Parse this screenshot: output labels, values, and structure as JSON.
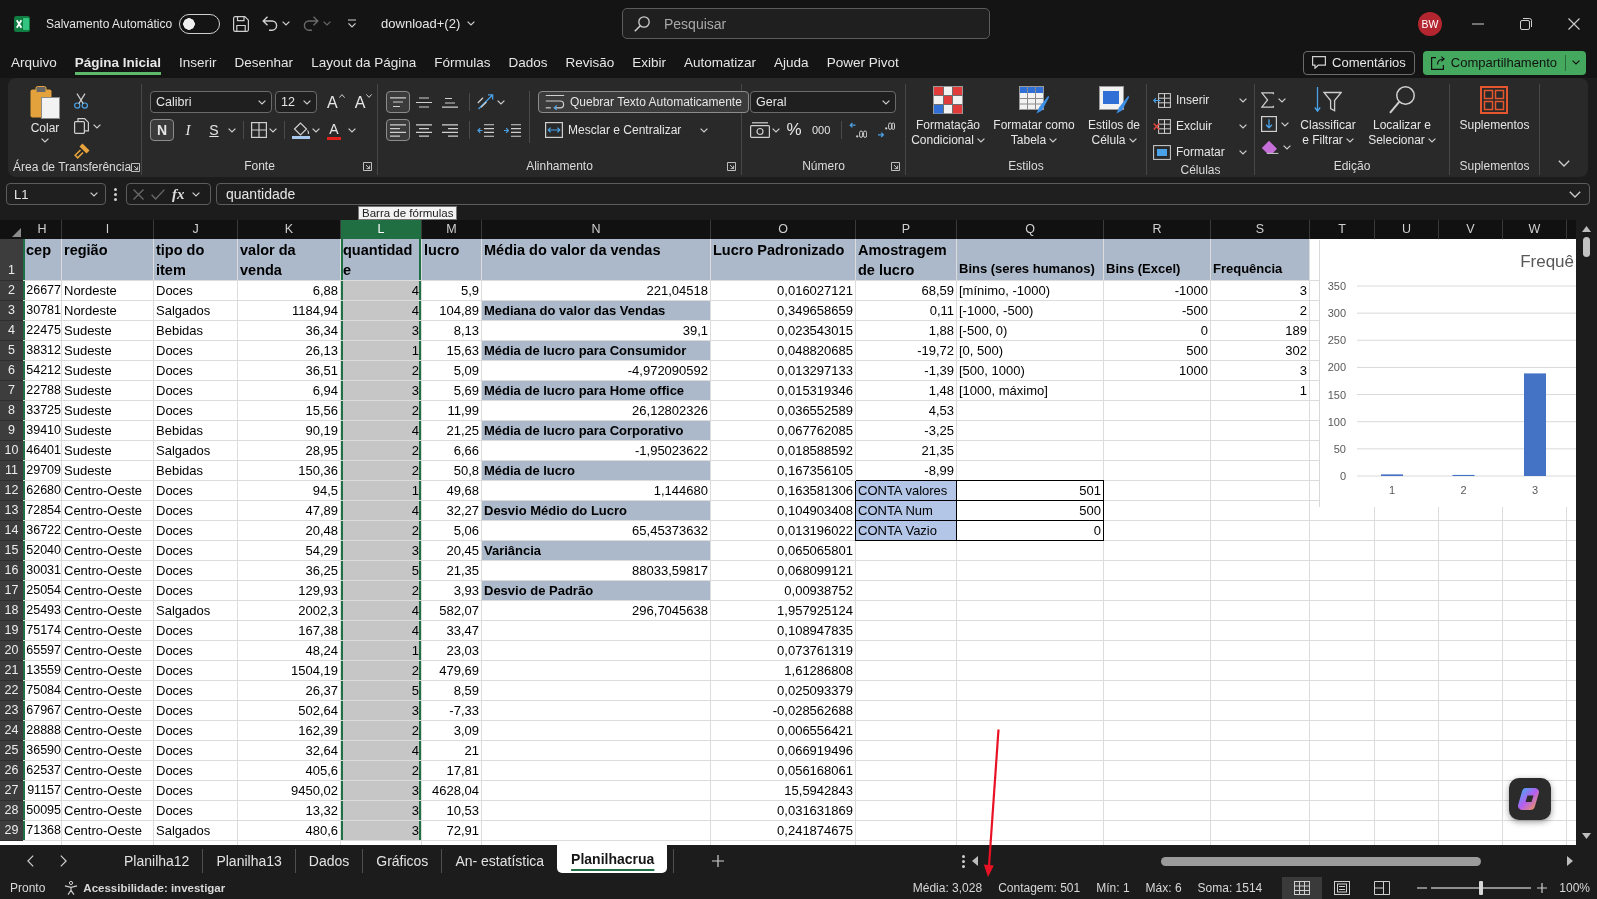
{
  "titlebar": {
    "autosave": {
      "label": "Salvamento Automático",
      "on": false
    },
    "quick_access": [
      {
        "kind": "save",
        "disabled": false
      },
      {
        "kind": "undo",
        "disabled": false
      },
      {
        "kind": "redo",
        "disabled": true
      }
    ],
    "file_name": "download+(2)",
    "search": {
      "placeholder": "Pesquisar"
    },
    "avatar": "BW"
  },
  "menu": {
    "tabs": [
      {
        "label": "Arquivo",
        "selected": false
      },
      {
        "label": "Página Inicial",
        "selected": true
      },
      {
        "label": "Inserir",
        "selected": false
      },
      {
        "label": "Desenhar",
        "selected": false
      },
      {
        "label": "Layout da Página",
        "selected": false
      },
      {
        "label": "Fórmulas",
        "selected": false
      },
      {
        "label": "Dados",
        "selected": false
      },
      {
        "label": "Revisão",
        "selected": false
      },
      {
        "label": "Exibir",
        "selected": false
      },
      {
        "label": "Automatizar",
        "selected": false
      },
      {
        "label": "Ajuda",
        "selected": false
      },
      {
        "label": "Power Pivot",
        "selected": false
      }
    ],
    "comments": "Comentários",
    "share": "Compartilhamento"
  },
  "ribbon": {
    "clipboard": {
      "label": "Área de Transferência",
      "paste": "Colar"
    },
    "font": {
      "label": "Fonte",
      "family": "Calibri",
      "size": "12",
      "grow": "A",
      "shrink": "A",
      "styles": [
        {
          "kind": "bold",
          "label": "N",
          "on": true
        },
        {
          "kind": "italic",
          "label": "I",
          "on": false
        },
        {
          "kind": "underline",
          "label": "S",
          "on": false
        }
      ],
      "paint_letter": "A"
    },
    "alignment": {
      "label": "Alinhamento",
      "vertical": [
        {
          "kind": "top",
          "on": true
        },
        {
          "kind": "middle",
          "on": false
        },
        {
          "kind": "bottom",
          "on": false
        }
      ],
      "horizontal": [
        {
          "kind": "left",
          "on": true
        },
        {
          "kind": "center",
          "on": false
        },
        {
          "kind": "right",
          "on": false
        }
      ],
      "wrap": {
        "label": "Quebrar Texto Automaticamente",
        "on": true
      },
      "merge": "Mesclar e Centralizar"
    },
    "number": {
      "label": "Número",
      "format": "Geral",
      "percent": "%",
      "thousands": "000"
    },
    "styles": {
      "label": "Estilos",
      "buttons": [
        "Formatação Condicional",
        "Formatar como Tabela",
        "Estilos de Célula"
      ]
    },
    "cells": {
      "label": "Células",
      "buttons": [
        "Inserir",
        "Excluir",
        "Formatar"
      ]
    },
    "editing": {
      "label": "Edição",
      "buttons": [
        "Classificar e Filtrar",
        "Localizar e Selecionar"
      ]
    },
    "addins": {
      "label": "Suplementos",
      "button": "Suplementos"
    }
  },
  "formula_bar": {
    "name_box": "L1",
    "function_label": "fx",
    "value": "quantidade",
    "tooltip": "Barra de fórmulas"
  },
  "sheet": {
    "columns": [
      {
        "label": "H",
        "selected": false
      },
      {
        "label": "I",
        "selected": false
      },
      {
        "label": "J",
        "selected": false
      },
      {
        "label": "K",
        "selected": false
      },
      {
        "label": "L",
        "selected": true
      },
      {
        "label": "M",
        "selected": false
      },
      {
        "label": "N",
        "selected": false
      },
      {
        "label": "O",
        "selected": false
      },
      {
        "label": "P",
        "selected": false
      },
      {
        "label": "Q",
        "selected": false
      },
      {
        "label": "R",
        "selected": false
      },
      {
        "label": "S",
        "selected": false
      },
      {
        "label": "T",
        "selected": false
      },
      {
        "label": "U",
        "selected": false
      },
      {
        "label": "V",
        "selected": false
      },
      {
        "label": "W",
        "selected": false
      }
    ],
    "rows": [
      {
        "number": "1",
        "cells": {
          "H": {
            "text": "cep",
            "kind": "head"
          },
          "I": {
            "text": "região",
            "kind": "head"
          },
          "J": {
            "text": "tipo do item",
            "kind": "head"
          },
          "K": {
            "text": "valor da venda",
            "kind": "head"
          },
          "L": {
            "text": "quantidade",
            "kind": "head"
          },
          "M": {
            "text": "lucro",
            "kind": "head"
          },
          "N": {
            "text": "Média do valor da vendas",
            "kind": "head"
          },
          "O": {
            "text": "Lucro Padronizado",
            "kind": "head"
          },
          "P": {
            "text": "Amostragem de lucro",
            "kind": "head"
          },
          "Q": {
            "text": "Bins (seres humanos)",
            "kind": "head_low"
          },
          "R": {
            "text": "Bins (Excel)",
            "kind": "head_low"
          },
          "S": {
            "text": "Frequência",
            "kind": "head_low"
          }
        }
      },
      {
        "number": "2",
        "cells": {
          "H": {
            "text": "26677",
            "kind": "number"
          },
          "I": {
            "text": "Nordeste",
            "kind": "text"
          },
          "J": {
            "text": "Doces",
            "kind": "text"
          },
          "K": {
            "text": "6,88",
            "kind": "number"
          },
          "L": {
            "text": "4",
            "kind": "number"
          },
          "M": {
            "text": "5,9",
            "kind": "number"
          },
          "N": {
            "text": "221,04518",
            "kind": "number"
          },
          "O": {
            "text": "0,016027121",
            "kind": "number"
          },
          "P": {
            "text": "68,59",
            "kind": "number"
          },
          "Q": {
            "text": "[mínimo, -1000)",
            "kind": "text"
          },
          "R": {
            "text": "-1000",
            "kind": "number"
          },
          "S": {
            "text": "3",
            "kind": "number"
          }
        }
      },
      {
        "number": "3",
        "cells": {
          "H": {
            "text": "30781",
            "kind": "number"
          },
          "I": {
            "text": "Nordeste",
            "kind": "text"
          },
          "J": {
            "text": "Salgados",
            "kind": "text"
          },
          "K": {
            "text": "1184,94",
            "kind": "number"
          },
          "L": {
            "text": "4",
            "kind": "number"
          },
          "M": {
            "text": "104,89",
            "kind": "number"
          },
          "N": {
            "text": "Mediana do valor das Vendas",
            "kind": "label"
          },
          "O": {
            "text": "0,349658659",
            "kind": "number"
          },
          "P": {
            "text": "0,11",
            "kind": "number"
          },
          "Q": {
            "text": "[-1000, -500)",
            "kind": "text"
          },
          "R": {
            "text": "-500",
            "kind": "number"
          },
          "S": {
            "text": "2",
            "kind": "number"
          }
        }
      },
      {
        "number": "4",
        "cells": {
          "H": {
            "text": "22475",
            "kind": "number"
          },
          "I": {
            "text": "Sudeste",
            "kind": "text"
          },
          "J": {
            "text": "Bebidas",
            "kind": "text"
          },
          "K": {
            "text": "36,34",
            "kind": "number"
          },
          "L": {
            "text": "3",
            "kind": "number"
          },
          "M": {
            "text": "8,13",
            "kind": "number"
          },
          "N": {
            "text": "39,1",
            "kind": "number"
          },
          "O": {
            "text": "0,023543015",
            "kind": "number"
          },
          "P": {
            "text": "1,88",
            "kind": "number"
          },
          "Q": {
            "text": "[-500, 0)",
            "kind": "text"
          },
          "R": {
            "text": "0",
            "kind": "number"
          },
          "S": {
            "text": "189",
            "kind": "number"
          }
        }
      },
      {
        "number": "5",
        "cells": {
          "H": {
            "text": "38312",
            "kind": "number"
          },
          "I": {
            "text": "Sudeste",
            "kind": "text"
          },
          "J": {
            "text": "Doces",
            "kind": "text"
          },
          "K": {
            "text": "26,13",
            "kind": "number"
          },
          "L": {
            "text": "1",
            "kind": "number"
          },
          "M": {
            "text": "15,63",
            "kind": "number"
          },
          "N": {
            "text": "Média de lucro para Consumidor",
            "kind": "label"
          },
          "O": {
            "text": "0,048820685",
            "kind": "number"
          },
          "P": {
            "text": "-19,72",
            "kind": "number"
          },
          "Q": {
            "text": "[0, 500)",
            "kind": "text"
          },
          "R": {
            "text": "500",
            "kind": "number"
          },
          "S": {
            "text": "302",
            "kind": "number"
          }
        }
      },
      {
        "number": "6",
        "cells": {
          "H": {
            "text": "54212",
            "kind": "number"
          },
          "I": {
            "text": "Sudeste",
            "kind": "text"
          },
          "J": {
            "text": "Doces",
            "kind": "text"
          },
          "K": {
            "text": "36,51",
            "kind": "number"
          },
          "L": {
            "text": "2",
            "kind": "number"
          },
          "M": {
            "text": "5,09",
            "kind": "number"
          },
          "N": {
            "text": "-4,972090592",
            "kind": "number"
          },
          "O": {
            "text": "0,013297133",
            "kind": "number"
          },
          "P": {
            "text": "-1,39",
            "kind": "number"
          },
          "Q": {
            "text": "[500, 1000)",
            "kind": "text"
          },
          "R": {
            "text": "1000",
            "kind": "number"
          },
          "S": {
            "text": "3",
            "kind": "number"
          }
        }
      },
      {
        "number": "7",
        "cells": {
          "H": {
            "text": "22788",
            "kind": "number"
          },
          "I": {
            "text": "Sudeste",
            "kind": "text"
          },
          "J": {
            "text": "Doces",
            "kind": "text"
          },
          "K": {
            "text": "6,94",
            "kind": "number"
          },
          "L": {
            "text": "3",
            "kind": "number"
          },
          "M": {
            "text": "5,69",
            "kind": "number"
          },
          "N": {
            "text": "Média de lucro para Home office",
            "kind": "label"
          },
          "O": {
            "text": "0,015319346",
            "kind": "number"
          },
          "P": {
            "text": "1,48",
            "kind": "number"
          },
          "Q": {
            "text": "[1000, máximo]",
            "kind": "text"
          },
          "S": {
            "text": "1",
            "kind": "number"
          }
        }
      },
      {
        "number": "8",
        "cells": {
          "H": {
            "text": "33725",
            "kind": "number"
          },
          "I": {
            "text": "Sudeste",
            "kind": "text"
          },
          "J": {
            "text": "Doces",
            "kind": "text"
          },
          "K": {
            "text": "15,56",
            "kind": "number"
          },
          "L": {
            "text": "2",
            "kind": "number"
          },
          "M": {
            "text": "11,99",
            "kind": "number"
          },
          "N": {
            "text": "26,12802326",
            "kind": "number"
          },
          "O": {
            "text": "0,036552589",
            "kind": "number"
          },
          "P": {
            "text": "4,53",
            "kind": "number"
          }
        }
      },
      {
        "number": "9",
        "cells": {
          "H": {
            "text": "39410",
            "kind": "number"
          },
          "I": {
            "text": "Sudeste",
            "kind": "text"
          },
          "J": {
            "text": "Bebidas",
            "kind": "text"
          },
          "K": {
            "text": "90,19",
            "kind": "number"
          },
          "L": {
            "text": "4",
            "kind": "number"
          },
          "M": {
            "text": "21,25",
            "kind": "number"
          },
          "N": {
            "text": "Média de lucro para Corporativo",
            "kind": "label"
          },
          "O": {
            "text": "0,067762085",
            "kind": "number"
          },
          "P": {
            "text": "-3,25",
            "kind": "number"
          }
        }
      },
      {
        "number": "10",
        "cells": {
          "H": {
            "text": "46401",
            "kind": "number"
          },
          "I": {
            "text": "Sudeste",
            "kind": "text"
          },
          "J": {
            "text": "Salgados",
            "kind": "text"
          },
          "K": {
            "text": "28,95",
            "kind": "number"
          },
          "L": {
            "text": "2",
            "kind": "number"
          },
          "M": {
            "text": "6,66",
            "kind": "number"
          },
          "N": {
            "text": "-1,95023622",
            "kind": "number"
          },
          "O": {
            "text": "0,018588592",
            "kind": "number"
          },
          "P": {
            "text": "21,35",
            "kind": "number"
          }
        }
      },
      {
        "number": "11",
        "cells": {
          "H": {
            "text": "29709",
            "kind": "number"
          },
          "I": {
            "text": "Sudeste",
            "kind": "text"
          },
          "J": {
            "text": "Bebidas",
            "kind": "text"
          },
          "K": {
            "text": "150,36",
            "kind": "number"
          },
          "L": {
            "text": "2",
            "kind": "number"
          },
          "M": {
            "text": "50,8",
            "kind": "number"
          },
          "N": {
            "text": "Média de lucro",
            "kind": "label"
          },
          "O": {
            "text": "0,167356105",
            "kind": "number"
          },
          "P": {
            "text": "-8,99",
            "kind": "number"
          }
        }
      },
      {
        "number": "12",
        "cells": {
          "H": {
            "text": "62680",
            "kind": "number"
          },
          "I": {
            "text": "Centro-Oeste",
            "kind": "text"
          },
          "J": {
            "text": "Doces",
            "kind": "text"
          },
          "K": {
            "text": "94,5",
            "kind": "number"
          },
          "L": {
            "text": "1",
            "kind": "number"
          },
          "M": {
            "text": "49,68",
            "kind": "number"
          },
          "N": {
            "text": "1,144680",
            "kind": "number"
          },
          "O": {
            "text": "0,163581306",
            "kind": "number"
          },
          "P": {
            "text": "CONTA valores",
            "kind": "box_label"
          },
          "Q": {
            "text": "501",
            "kind": "box_value"
          }
        }
      },
      {
        "number": "13",
        "cells": {
          "H": {
            "text": "72854",
            "kind": "number"
          },
          "I": {
            "text": "Centro-Oeste",
            "kind": "text"
          },
          "J": {
            "text": "Doces",
            "kind": "text"
          },
          "K": {
            "text": "47,89",
            "kind": "number"
          },
          "L": {
            "text": "4",
            "kind": "number"
          },
          "M": {
            "text": "32,27",
            "kind": "number"
          },
          "N": {
            "text": "Desvio Médio do Lucro",
            "kind": "label"
          },
          "O": {
            "text": "0,104903408",
            "kind": "number"
          },
          "P": {
            "text": "CONTA Num",
            "kind": "box_label"
          },
          "Q": {
            "text": "500",
            "kind": "box_value"
          }
        }
      },
      {
        "number": "14",
        "cells": {
          "H": {
            "text": "36722",
            "kind": "number"
          },
          "I": {
            "text": "Centro-Oeste",
            "kind": "text"
          },
          "J": {
            "text": "Doces",
            "kind": "text"
          },
          "K": {
            "text": "20,48",
            "kind": "number"
          },
          "L": {
            "text": "2",
            "kind": "number"
          },
          "M": {
            "text": "5,06",
            "kind": "number"
          },
          "N": {
            "text": "65,45373632",
            "kind": "number"
          },
          "O": {
            "text": "0,013196022",
            "kind": "number"
          },
          "P": {
            "text": "CONTA Vazio",
            "kind": "box_label"
          },
          "Q": {
            "text": "0",
            "kind": "box_value"
          }
        }
      },
      {
        "number": "15",
        "cells": {
          "H": {
            "text": "52040",
            "kind": "number"
          },
          "I": {
            "text": "Centro-Oeste",
            "kind": "text"
          },
          "J": {
            "text": "Doces",
            "kind": "text"
          },
          "K": {
            "text": "54,29",
            "kind": "number"
          },
          "L": {
            "text": "3",
            "kind": "number"
          },
          "M": {
            "text": "20,45",
            "kind": "number"
          },
          "N": {
            "text": "Variância",
            "kind": "label"
          },
          "O": {
            "text": "0,065065801",
            "kind": "number"
          }
        }
      },
      {
        "number": "16",
        "cells": {
          "H": {
            "text": "30031",
            "kind": "number"
          },
          "I": {
            "text": "Centro-Oeste",
            "kind": "text"
          },
          "J": {
            "text": "Doces",
            "kind": "text"
          },
          "K": {
            "text": "36,25",
            "kind": "number"
          },
          "L": {
            "text": "5",
            "kind": "number"
          },
          "M": {
            "text": "21,35",
            "kind": "number"
          },
          "N": {
            "text": "88033,59817",
            "kind": "number"
          },
          "O": {
            "text": "0,068099121",
            "kind": "number"
          }
        }
      },
      {
        "number": "17",
        "cells": {
          "H": {
            "text": "25054",
            "kind": "number"
          },
          "I": {
            "text": "Centro-Oeste",
            "kind": "text"
          },
          "J": {
            "text": "Doces",
            "kind": "text"
          },
          "K": {
            "text": "129,93",
            "kind": "number"
          },
          "L": {
            "text": "2",
            "kind": "number"
          },
          "M": {
            "text": "3,93",
            "kind": "number"
          },
          "N": {
            "text": "Desvio de Padrão",
            "kind": "label"
          },
          "O": {
            "text": "0,00938752",
            "kind": "number"
          }
        }
      },
      {
        "number": "18",
        "cells": {
          "H": {
            "text": "25493",
            "kind": "number"
          },
          "I": {
            "text": "Centro-Oeste",
            "kind": "text"
          },
          "J": {
            "text": "Salgados",
            "kind": "text"
          },
          "K": {
            "text": "2002,3",
            "kind": "number"
          },
          "L": {
            "text": "4",
            "kind": "number"
          },
          "M": {
            "text": "582,07",
            "kind": "number"
          },
          "N": {
            "text": "296,7045638",
            "kind": "number"
          },
          "O": {
            "text": "1,957925124",
            "kind": "number"
          }
        }
      },
      {
        "number": "19",
        "cells": {
          "H": {
            "text": "75174",
            "kind": "number"
          },
          "I": {
            "text": "Centro-Oeste",
            "kind": "text"
          },
          "J": {
            "text": "Doces",
            "kind": "text"
          },
          "K": {
            "text": "167,38",
            "kind": "number"
          },
          "L": {
            "text": "4",
            "kind": "number"
          },
          "M": {
            "text": "33,47",
            "kind": "number"
          },
          "O": {
            "text": "0,108947835",
            "kind": "number"
          }
        }
      },
      {
        "number": "20",
        "cells": {
          "H": {
            "text": "65597",
            "kind": "number"
          },
          "I": {
            "text": "Centro-Oeste",
            "kind": "text"
          },
          "J": {
            "text": "Doces",
            "kind": "text"
          },
          "K": {
            "text": "48,24",
            "kind": "number"
          },
          "L": {
            "text": "1",
            "kind": "number"
          },
          "M": {
            "text": "23,03",
            "kind": "number"
          },
          "O": {
            "text": "0,073761319",
            "kind": "number"
          }
        }
      },
      {
        "number": "21",
        "cells": {
          "H": {
            "text": "13559",
            "kind": "number"
          },
          "I": {
            "text": "Centro-Oeste",
            "kind": "text"
          },
          "J": {
            "text": "Doces",
            "kind": "text"
          },
          "K": {
            "text": "1504,19",
            "kind": "number"
          },
          "L": {
            "text": "2",
            "kind": "number"
          },
          "M": {
            "text": "479,69",
            "kind": "number"
          },
          "O": {
            "text": "1,61286808",
            "kind": "number"
          }
        }
      },
      {
        "number": "22",
        "cells": {
          "H": {
            "text": "75084",
            "kind": "number"
          },
          "I": {
            "text": "Centro-Oeste",
            "kind": "text"
          },
          "J": {
            "text": "Doces",
            "kind": "text"
          },
          "K": {
            "text": "26,37",
            "kind": "number"
          },
          "L": {
            "text": "5",
            "kind": "number"
          },
          "M": {
            "text": "8,59",
            "kind": "number"
          },
          "O": {
            "text": "0,025093379",
            "kind": "number"
          }
        }
      },
      {
        "number": "23",
        "cells": {
          "H": {
            "text": "67967",
            "kind": "number"
          },
          "I": {
            "text": "Centro-Oeste",
            "kind": "text"
          },
          "J": {
            "text": "Doces",
            "kind": "text"
          },
          "K": {
            "text": "502,64",
            "kind": "number"
          },
          "L": {
            "text": "3",
            "kind": "number"
          },
          "M": {
            "text": "-7,33",
            "kind": "number"
          },
          "O": {
            "text": "-0,028562688",
            "kind": "number"
          }
        }
      },
      {
        "number": "24",
        "cells": {
          "H": {
            "text": "28888",
            "kind": "number"
          },
          "I": {
            "text": "Centro-Oeste",
            "kind": "text"
          },
          "J": {
            "text": "Doces",
            "kind": "text"
          },
          "K": {
            "text": "162,39",
            "kind": "number"
          },
          "L": {
            "text": "2",
            "kind": "number"
          },
          "M": {
            "text": "3,09",
            "kind": "number"
          },
          "O": {
            "text": "0,006556421",
            "kind": "number"
          }
        }
      },
      {
        "number": "25",
        "cells": {
          "H": {
            "text": "36590",
            "kind": "number"
          },
          "I": {
            "text": "Centro-Oeste",
            "kind": "text"
          },
          "J": {
            "text": "Doces",
            "kind": "text"
          },
          "K": {
            "text": "32,64",
            "kind": "number"
          },
          "L": {
            "text": "4",
            "kind": "number"
          },
          "M": {
            "text": "21",
            "kind": "number"
          },
          "O": {
            "text": "0,066919496",
            "kind": "number"
          }
        }
      },
      {
        "number": "26",
        "cells": {
          "H": {
            "text": "62537",
            "kind": "number"
          },
          "I": {
            "text": "Centro-Oeste",
            "kind": "text"
          },
          "J": {
            "text": "Doces",
            "kind": "text"
          },
          "K": {
            "text": "405,6",
            "kind": "number"
          },
          "L": {
            "text": "2",
            "kind": "number"
          },
          "M": {
            "text": "17,81",
            "kind": "number"
          },
          "O": {
            "text": "0,056168061",
            "kind": "number"
          }
        }
      },
      {
        "number": "27",
        "cells": {
          "H": {
            "text": "91157",
            "kind": "number"
          },
          "I": {
            "text": "Centro-Oeste",
            "kind": "text"
          },
          "J": {
            "text": "Doces",
            "kind": "text"
          },
          "K": {
            "text": "9450,02",
            "kind": "number"
          },
          "L": {
            "text": "3",
            "kind": "number"
          },
          "M": {
            "text": "4628,04",
            "kind": "number"
          },
          "O": {
            "text": "15,5942843",
            "kind": "number"
          }
        }
      },
      {
        "number": "28",
        "cells": {
          "H": {
            "text": "50095",
            "kind": "number"
          },
          "I": {
            "text": "Centro-Oeste",
            "kind": "text"
          },
          "J": {
            "text": "Doces",
            "kind": "text"
          },
          "K": {
            "text": "13,32",
            "kind": "number"
          },
          "L": {
            "text": "3",
            "kind": "number"
          },
          "M": {
            "text": "10,53",
            "kind": "number"
          },
          "O": {
            "text": "0,031631869",
            "kind": "number"
          }
        }
      },
      {
        "number": "29",
        "cells": {
          "H": {
            "text": "71368",
            "kind": "number"
          },
          "I": {
            "text": "Centro-Oeste",
            "kind": "text"
          },
          "J": {
            "text": "Salgados",
            "kind": "text"
          },
          "K": {
            "text": "480,6",
            "kind": "number"
          },
          "L": {
            "text": "3",
            "kind": "number"
          },
          "M": {
            "text": "72,91",
            "kind": "number"
          },
          "O": {
            "text": "0,241874675",
            "kind": "number"
          }
        }
      }
    ],
    "chart_data": {
      "type": "bar",
      "title": "Frequê",
      "categories": [
        "1",
        "2",
        "3"
      ],
      "values": [
        3,
        2,
        189
      ],
      "ylim": [
        0,
        350
      ],
      "yticks": [
        {
          "value": 0,
          "label": "0"
        },
        {
          "value": 50,
          "label": "50"
        },
        {
          "value": 100,
          "label": "100"
        },
        {
          "value": 150,
          "label": "150"
        },
        {
          "value": 200,
          "label": "200"
        },
        {
          "value": 250,
          "label": "250"
        },
        {
          "value": 300,
          "label": "300"
        },
        {
          "value": 350,
          "label": "350"
        }
      ],
      "grid": true
    }
  },
  "sheet_tabs": [
    {
      "label": "Planilha12",
      "selected": false
    },
    {
      "label": "Planilha13",
      "selected": false
    },
    {
      "label": "Dados",
      "selected": false
    },
    {
      "label": "Gráficos",
      "selected": false
    },
    {
      "label": "An- estatística",
      "selected": false
    },
    {
      "label": "Planilhacrua",
      "selected": true
    }
  ],
  "status_bar": {
    "mode": "Pronto",
    "accessibility": "Acessibilidade: investigar",
    "stats": [
      "Média: 3,028",
      "Contagem: 501",
      "Mín: 1",
      "Máx: 6",
      "Soma: 1514"
    ],
    "views": [
      {
        "kind": "normal",
        "selected": true
      },
      {
        "kind": "page_layout",
        "selected": false
      },
      {
        "kind": "page_break",
        "selected": false
      }
    ],
    "zoom": {
      "level": 0.5,
      "reading": "100%"
    }
  }
}
